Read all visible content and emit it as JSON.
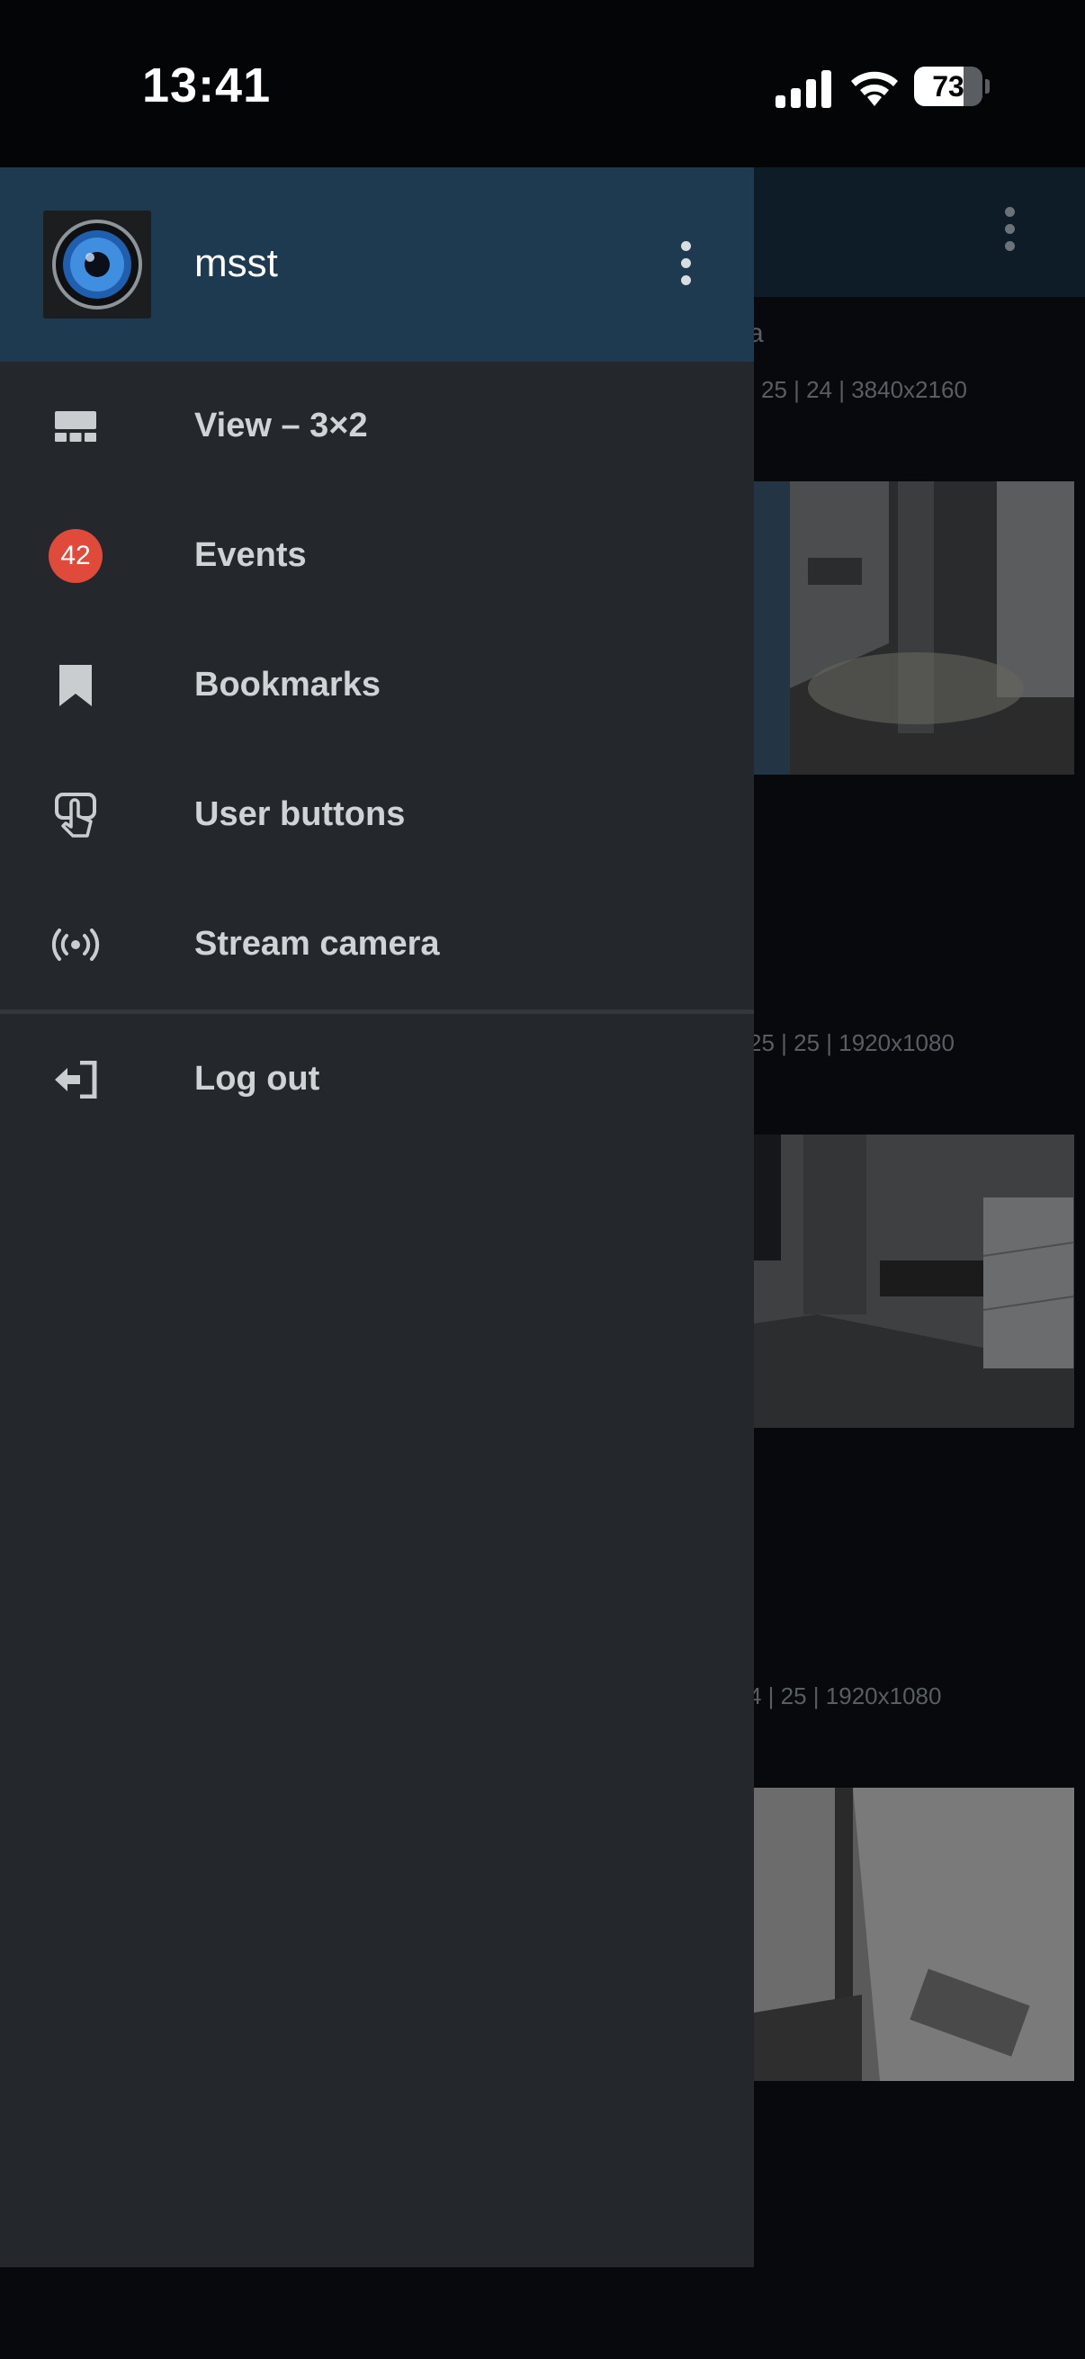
{
  "status_bar": {
    "time": "13:41",
    "battery_level": "73",
    "battery_fraction": 0.73
  },
  "background": {
    "title_fragment": "a",
    "cameras": [
      {
        "info": "| 25 | 24 | 3840x2160"
      },
      {
        "info": "25 | 25 | 1920x1080"
      },
      {
        "info": "4 | 25 | 1920x1080"
      }
    ]
  },
  "drawer": {
    "username": "msst",
    "items": [
      {
        "label": "View – 3×2",
        "icon": "grid-layout-icon"
      },
      {
        "label": "Events",
        "icon": "events-badge",
        "badge": "42"
      },
      {
        "label": "Bookmarks",
        "icon": "bookmark-icon"
      },
      {
        "label": "User buttons",
        "icon": "touch-button-icon"
      },
      {
        "label": "Stream camera",
        "icon": "broadcast-icon"
      },
      {
        "label": "Log out",
        "icon": "logout-icon"
      }
    ]
  },
  "colors": {
    "drawer_bg": "#24282c",
    "drawer_header": "#1d3a50",
    "badge": "#e04a3a",
    "app_bg": "#07090c"
  }
}
